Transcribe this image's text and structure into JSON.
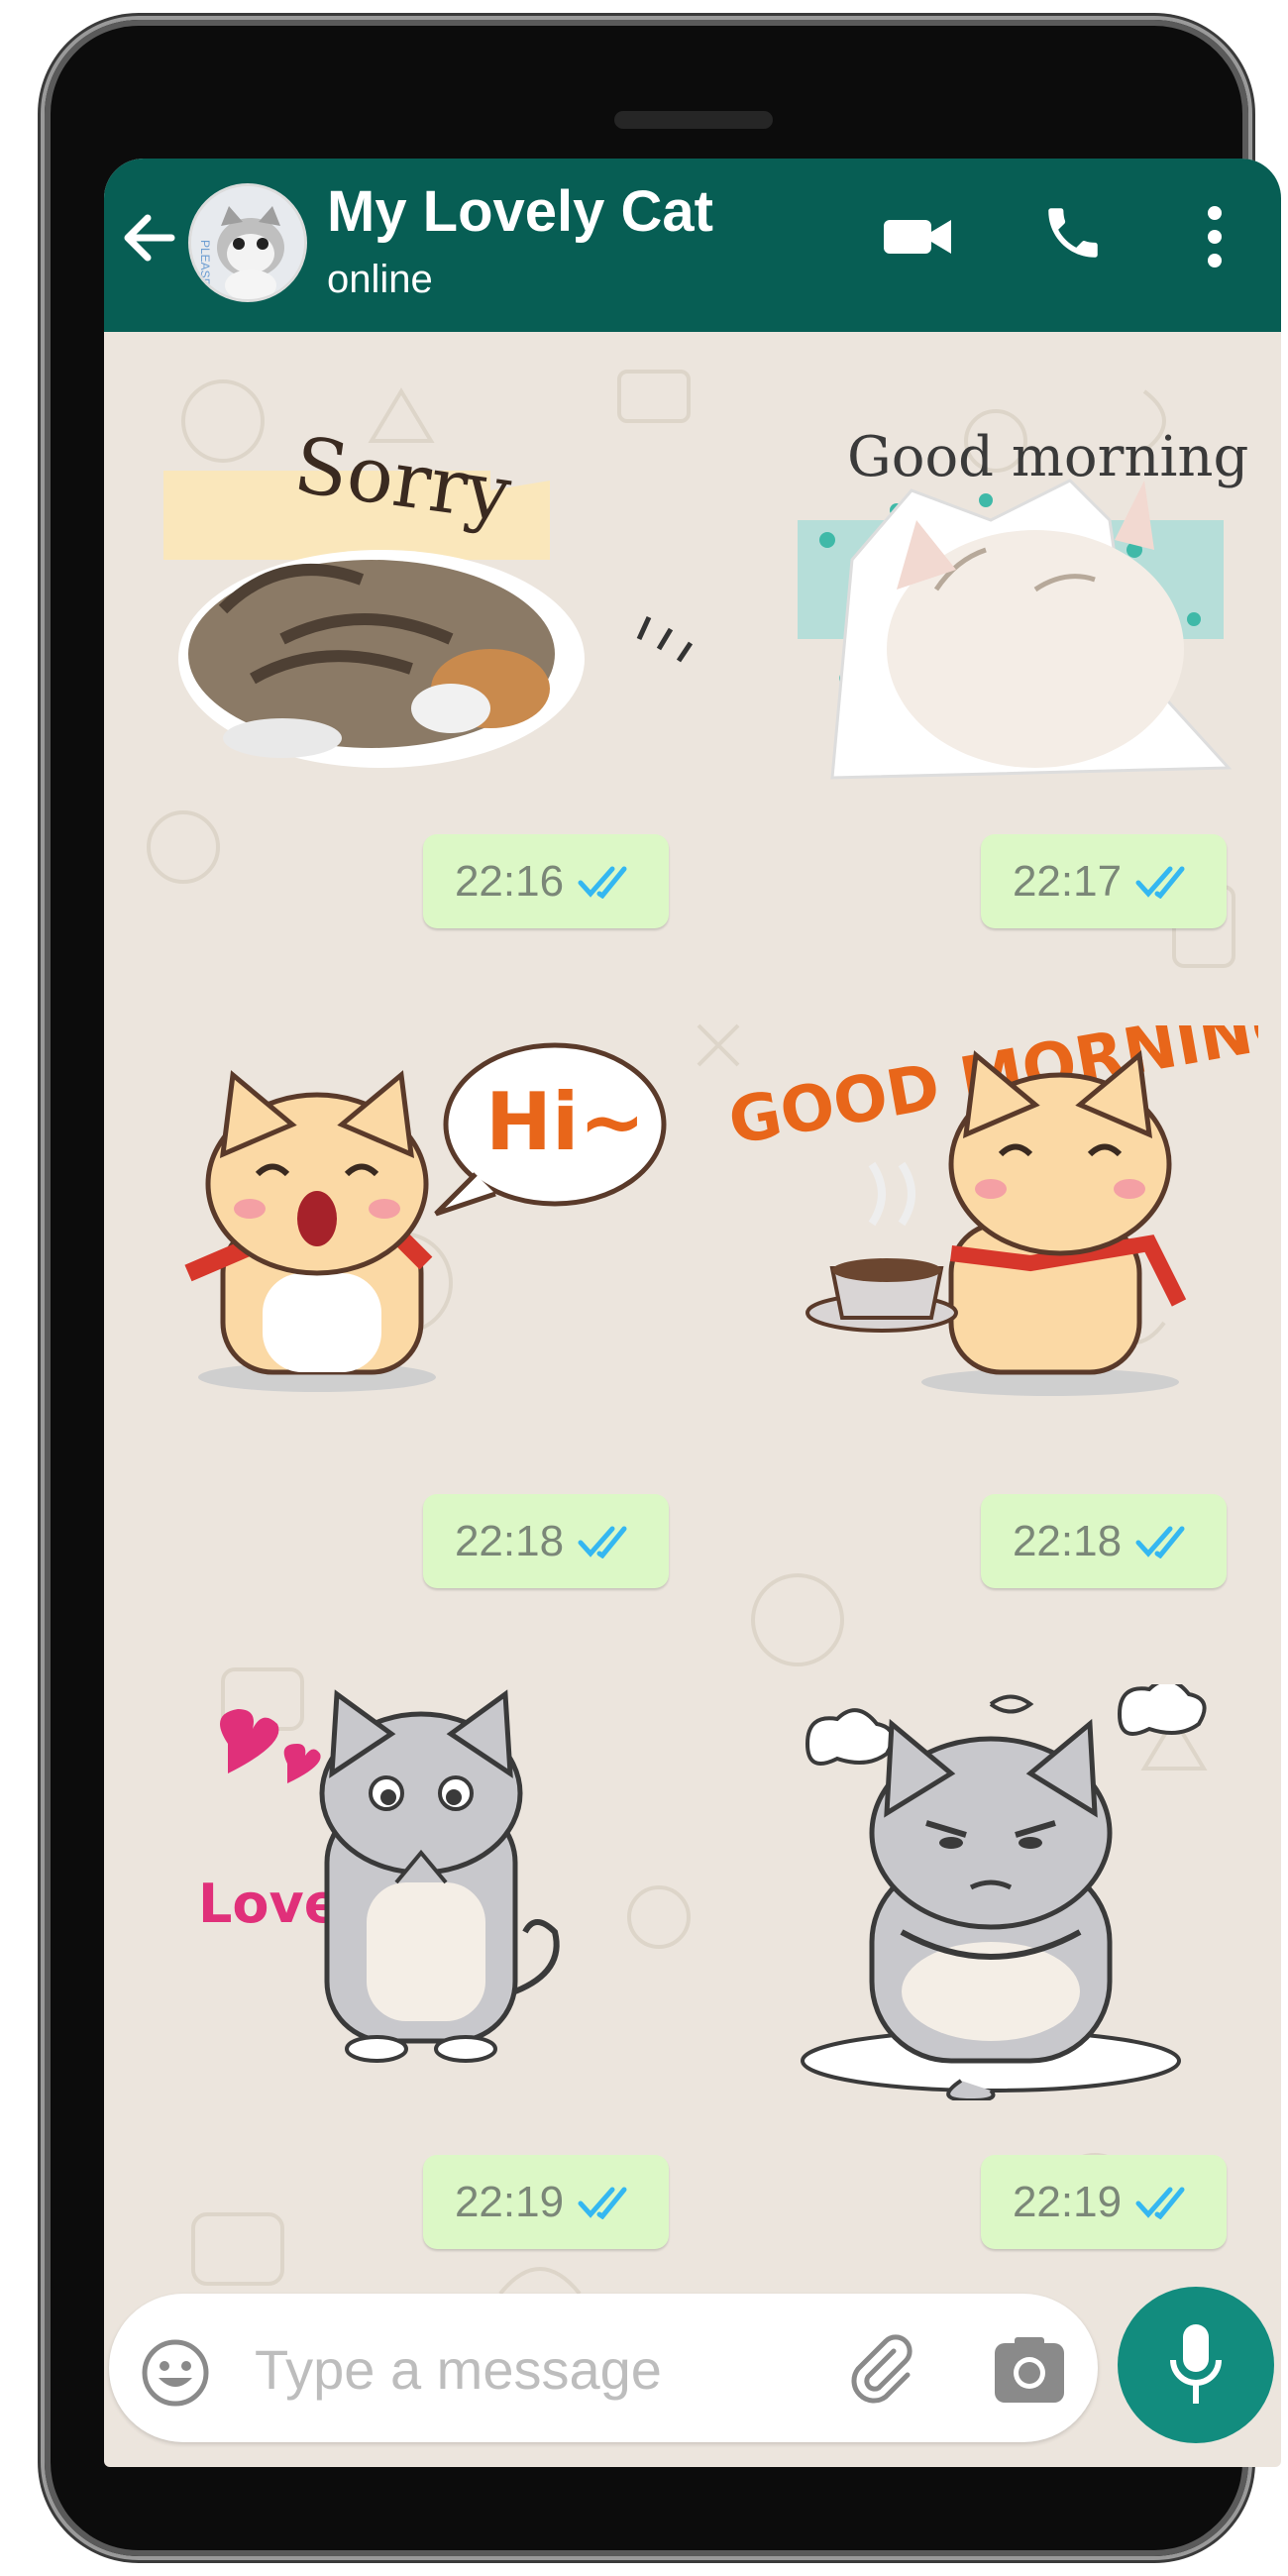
{
  "header": {
    "title": "My Lovely Cat",
    "status": "online",
    "avatar_label": "PLEASE"
  },
  "messages": [
    {
      "sticker": "Sorry",
      "time": "22:16",
      "read": true
    },
    {
      "sticker": "Good morning",
      "time": "22:17",
      "read": true
    },
    {
      "sticker": "Hi~",
      "time": "22:18",
      "read": true
    },
    {
      "sticker": "GOOD MORNING",
      "time": "22:18",
      "read": true
    },
    {
      "sticker": "Love you",
      "time": "22:19",
      "read": true
    },
    {
      "sticker": "",
      "time": "22:19",
      "read": true
    }
  ],
  "composer": {
    "placeholder": "Type a message"
  },
  "colors": {
    "header": "#075e54",
    "bubble": "#dcf8c6",
    "mic": "#128c7e",
    "tick": "#34b7f1",
    "wallpaper": "#ece5dd"
  },
  "icons": [
    "back-arrow-icon",
    "video-call-icon",
    "phone-icon",
    "more-vert-icon",
    "emoji-icon",
    "attach-icon",
    "camera-icon",
    "mic-icon",
    "double-check-icon"
  ]
}
